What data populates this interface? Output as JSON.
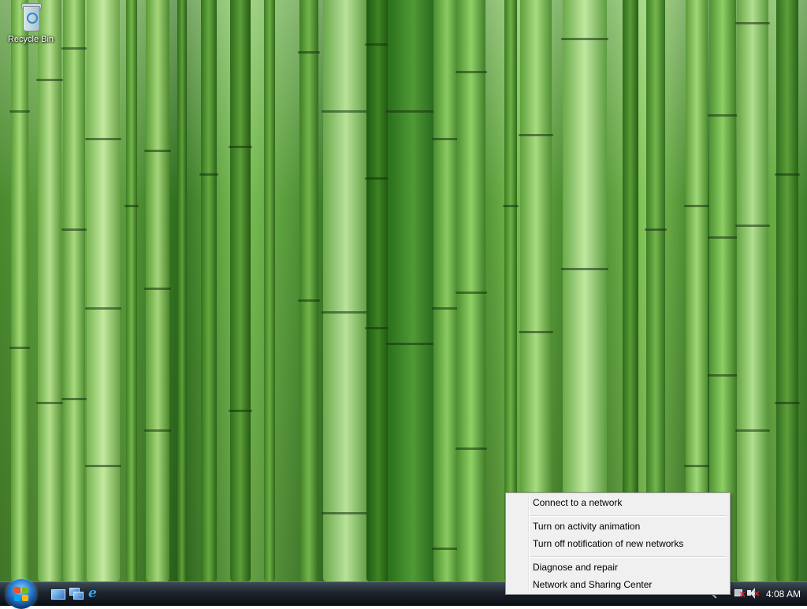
{
  "desktop": {
    "icons": [
      {
        "label": "Recycle Bin",
        "icon": "recycle-bin-icon"
      }
    ]
  },
  "taskbar": {
    "start": {
      "icon": "windows-start-orb-icon"
    },
    "quick_launch": [
      {
        "icon": "show-desktop-icon"
      },
      {
        "icon": "switch-windows-icon"
      },
      {
        "icon": "internet-explorer-icon"
      }
    ],
    "tray": {
      "icons": [
        "show-hidden-icons-chevron",
        "network-disconnected-icon",
        "volume-muted-icon"
      ],
      "clock": "4:08 AM"
    }
  },
  "context_menu": {
    "items": [
      {
        "label": "Connect to a network"
      },
      {
        "label": "Turn on activity animation"
      },
      {
        "label": "Turn off notification of new networks"
      },
      {
        "label": "Diagnose and repair"
      },
      {
        "label": "Network and Sharing Center"
      }
    ]
  },
  "colors": {
    "wallpaper_green": "#4f9a35",
    "menu_background": "#f0f0f0",
    "taskbar": "#1d242c",
    "alert_red": "#e02020"
  }
}
